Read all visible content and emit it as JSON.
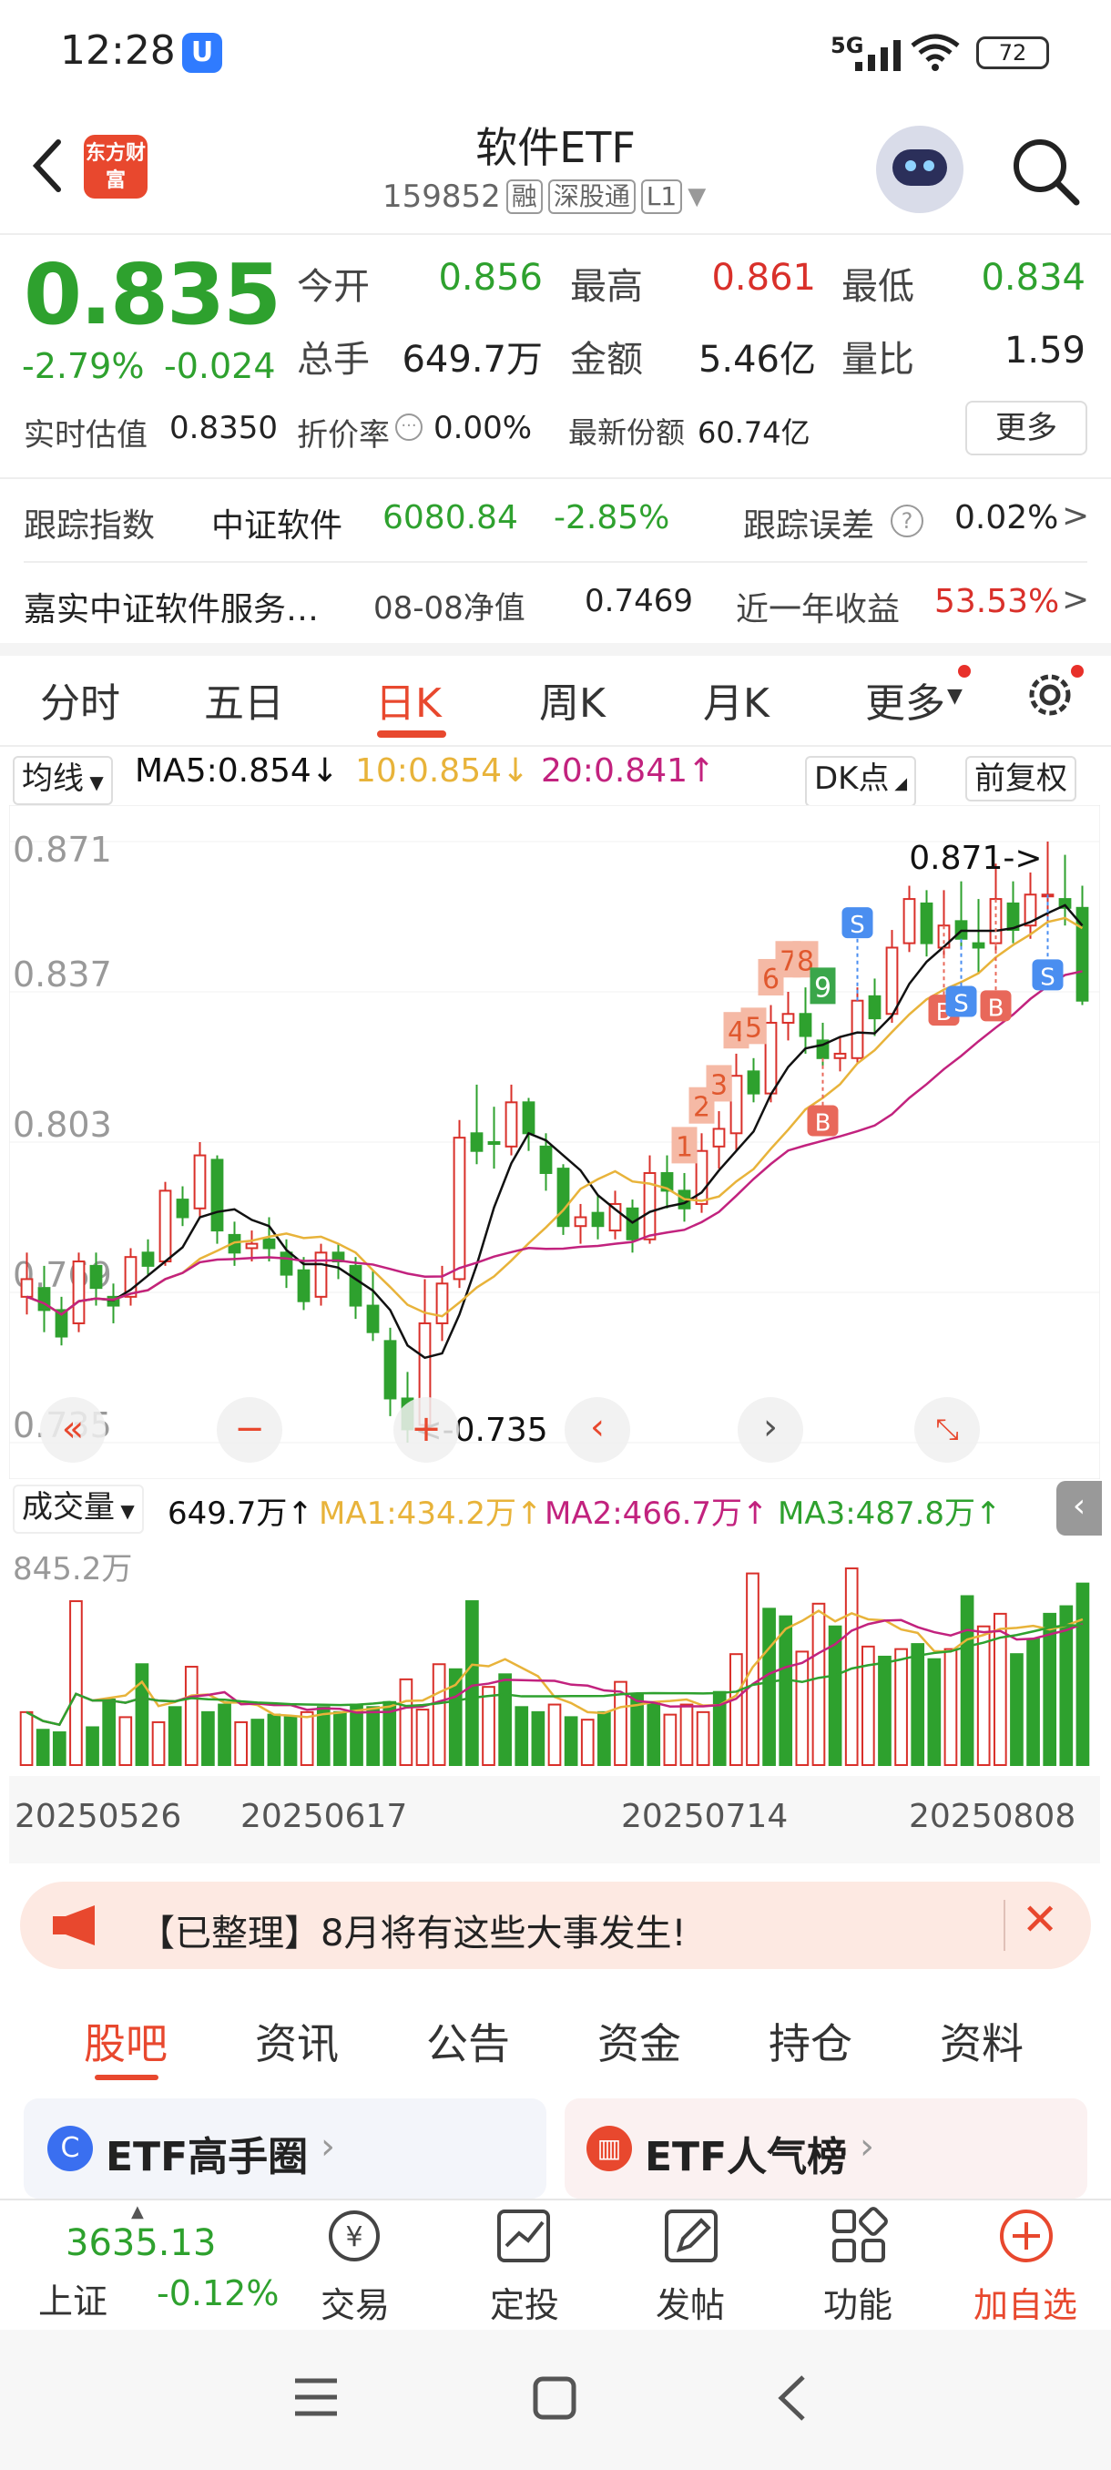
{
  "status_bar": {
    "time": "12:28",
    "network": "5G",
    "battery": "72"
  },
  "header": {
    "logo_text": "东方财富",
    "title": "软件ETF",
    "code": "159852",
    "tags": [
      "融",
      "深股通",
      "L1"
    ]
  },
  "quote": {
    "price": "0.835",
    "change_pct": "-2.79%",
    "change_amt": "-0.024",
    "fields": [
      {
        "label": "今开",
        "value": "0.856",
        "color": "green"
      },
      {
        "label": "最高",
        "value": "0.861",
        "color": "red"
      },
      {
        "label": "最低",
        "value": "0.834",
        "color": "green"
      },
      {
        "label": "总手",
        "value": "649.7万",
        "color": "black"
      },
      {
        "label": "金额",
        "value": "5.46亿",
        "color": "black"
      },
      {
        "label": "量比",
        "value": "1.59",
        "color": "black"
      }
    ],
    "iopv_label": "实时估值",
    "iopv_value": "0.8350",
    "premium_label": "折价率",
    "premium_value": "0.00%",
    "shares_label": "最新份额",
    "shares_value": "60.74亿",
    "more_label": "更多"
  },
  "tracking": {
    "index_label": "跟踪指数",
    "index_name": "中证软件",
    "index_value": "6080.84",
    "index_pct": "-2.85%",
    "error_label": "跟踪误差",
    "error_value": "0.02%",
    "fund_name": "嘉实中证软件服务…",
    "nav_label": "08-08净值",
    "nav_value": "0.7469",
    "year_label": "近一年收益",
    "year_value": "53.53%"
  },
  "period_tabs": [
    "分时",
    "五日",
    "日K",
    "周K",
    "月K",
    "更多"
  ],
  "active_period": "日K",
  "chart_toolbar": {
    "ma_selector": "均线",
    "ma5": "MA5:0.854↓",
    "ma10": "10:0.854↓",
    "ma20": "20:0.841↑",
    "dk_label": "DK点",
    "adjust_label": "前复权"
  },
  "chart_data": {
    "type": "candlestick",
    "y_ticks": [
      "0.871",
      "0.837",
      "0.803",
      "0.769",
      "0.735"
    ],
    "ylim": [
      0.735,
      0.871
    ],
    "high_marker": "0.871->",
    "low_marker": "<-0.735",
    "x_ticks": [
      "20250526",
      "20250617",
      "20250714",
      "20250808"
    ],
    "candles": [
      [
        0.772,
        0.768,
        0.778,
        0.764,
        "up"
      ],
      [
        0.77,
        0.765,
        0.775,
        0.76,
        "down"
      ],
      [
        0.765,
        0.759,
        0.768,
        0.757,
        "down"
      ],
      [
        0.762,
        0.776,
        0.778,
        0.76,
        "up"
      ],
      [
        0.775,
        0.77,
        0.778,
        0.766,
        "down"
      ],
      [
        0.768,
        0.766,
        0.771,
        0.762,
        "down"
      ],
      [
        0.768,
        0.777,
        0.779,
        0.766,
        "up"
      ],
      [
        0.778,
        0.775,
        0.781,
        0.773,
        "down"
      ],
      [
        0.776,
        0.792,
        0.794,
        0.775,
        "up"
      ],
      [
        0.79,
        0.786,
        0.793,
        0.784,
        "down"
      ],
      [
        0.788,
        0.8,
        0.803,
        0.786,
        "up"
      ],
      [
        0.799,
        0.783,
        0.8,
        0.78,
        "down"
      ],
      [
        0.782,
        0.778,
        0.785,
        0.775,
        "down"
      ],
      [
        0.779,
        0.78,
        0.783,
        0.776,
        "up"
      ],
      [
        0.781,
        0.779,
        0.786,
        0.776,
        "down"
      ],
      [
        0.778,
        0.773,
        0.781,
        0.77,
        "down"
      ],
      [
        0.774,
        0.767,
        0.777,
        0.765,
        "down"
      ],
      [
        0.768,
        0.778,
        0.78,
        0.766,
        "up"
      ],
      [
        0.778,
        0.776,
        0.78,
        0.772,
        "down"
      ],
      [
        0.775,
        0.766,
        0.777,
        0.763,
        "down"
      ],
      [
        0.766,
        0.76,
        0.774,
        0.758,
        "down"
      ],
      [
        0.758,
        0.745,
        0.761,
        0.741,
        "down"
      ],
      [
        0.745,
        0.738,
        0.751,
        0.735,
        "down"
      ],
      [
        0.739,
        0.762,
        0.772,
        0.738,
        "up"
      ],
      [
        0.762,
        0.771,
        0.775,
        0.758,
        "up"
      ],
      [
        0.772,
        0.804,
        0.808,
        0.77,
        "up"
      ],
      [
        0.805,
        0.801,
        0.816,
        0.798,
        "down"
      ],
      [
        0.803,
        0.803,
        0.811,
        0.797,
        "down"
      ],
      [
        0.802,
        0.812,
        0.816,
        0.8,
        "up"
      ],
      [
        0.812,
        0.805,
        0.813,
        0.801,
        "down"
      ],
      [
        0.802,
        0.796,
        0.805,
        0.792,
        "down"
      ],
      [
        0.797,
        0.784,
        0.798,
        0.782,
        "down"
      ],
      [
        0.784,
        0.786,
        0.789,
        0.78,
        "up"
      ],
      [
        0.787,
        0.784,
        0.791,
        0.781,
        "down"
      ],
      [
        0.783,
        0.789,
        0.792,
        0.781,
        "up"
      ],
      [
        0.788,
        0.781,
        0.79,
        0.778,
        "down"
      ],
      [
        0.781,
        0.796,
        0.8,
        0.78,
        "up"
      ],
      [
        0.796,
        0.792,
        0.8,
        0.788,
        "down"
      ],
      [
        0.792,
        0.788,
        0.796,
        0.785,
        "down"
      ],
      [
        0.789,
        0.801,
        0.805,
        0.787,
        "up"
      ],
      [
        0.802,
        0.806,
        0.81,
        0.797,
        "up"
      ],
      [
        0.805,
        0.818,
        0.823,
        0.801,
        "up"
      ],
      [
        0.819,
        0.814,
        0.822,
        0.812,
        "down"
      ],
      [
        0.814,
        0.83,
        0.834,
        0.812,
        "up"
      ],
      [
        0.83,
        0.832,
        0.837,
        0.826,
        "up"
      ],
      [
        0.832,
        0.827,
        0.838,
        0.823,
        "down"
      ],
      [
        0.826,
        0.822,
        0.83,
        0.82,
        "down"
      ],
      [
        0.822,
        0.823,
        0.827,
        0.819,
        "up"
      ],
      [
        0.822,
        0.835,
        0.838,
        0.821,
        "up"
      ],
      [
        0.836,
        0.831,
        0.84,
        0.827,
        "down"
      ],
      [
        0.832,
        0.847,
        0.851,
        0.83,
        "up"
      ],
      [
        0.848,
        0.858,
        0.861,
        0.846,
        "up"
      ],
      [
        0.857,
        0.848,
        0.86,
        0.845,
        "down"
      ],
      [
        0.847,
        0.852,
        0.86,
        0.845,
        "up"
      ],
      [
        0.853,
        0.849,
        0.862,
        0.847,
        "down"
      ],
      [
        0.848,
        0.847,
        0.858,
        0.841,
        "down"
      ],
      [
        0.848,
        0.858,
        0.866,
        0.846,
        "up"
      ],
      [
        0.857,
        0.851,
        0.862,
        0.848,
        "down"
      ],
      [
        0.852,
        0.859,
        0.864,
        0.849,
        "up"
      ],
      [
        0.859,
        0.859,
        0.871,
        0.853,
        "up"
      ],
      [
        0.858,
        0.856,
        0.868,
        0.852,
        "down"
      ],
      [
        0.856,
        0.835,
        0.861,
        0.834,
        "down"
      ]
    ],
    "ma5_last": 0.854,
    "ma10_last": 0.854,
    "ma20_last": 0.841,
    "signals": [
      "1",
      "2",
      "3",
      "4",
      "5",
      "6",
      "7",
      "8",
      "9"
    ],
    "buy_sell_labels": [
      "B",
      "S"
    ],
    "volume": {
      "selector": "成交量",
      "current": "649.7万↑",
      "ma1": "MA1:434.2万↑",
      "ma2": "MA2:466.7万↑",
      "ma3": "MA3:487.8万↑",
      "max_label": "845.2万",
      "values": [
        210,
        140,
        130,
        650,
        150,
        260,
        190,
        400,
        170,
        230,
        390,
        210,
        240,
        170,
        180,
        200,
        190,
        210,
        230,
        210,
        240,
        230,
        250,
        340,
        220,
        400,
        380,
        650,
        310,
        360,
        230,
        210,
        240,
        190,
        180,
        210,
        330,
        280,
        250,
        200,
        240,
        210,
        290,
        440,
        760,
        620,
        590,
        450,
        640,
        550,
        780,
        470,
        430,
        460,
        480,
        420,
        460,
        670,
        550,
        600,
        440,
        500,
        600,
        630,
        720
      ]
    }
  },
  "notice": {
    "text": "【已整理】8月将有这些大事发生!"
  },
  "content_tabs": [
    "股吧",
    "资讯",
    "公告",
    "资金",
    "持仓",
    "资料"
  ],
  "active_content_tab": "股吧",
  "cards": [
    {
      "title": "ETF高手圈"
    },
    {
      "title": "ETF人气榜"
    }
  ],
  "bottom_nav": {
    "index_value": "3635.13",
    "index_name": "上证",
    "index_pct": "-0.12%",
    "items": [
      "交易",
      "定投",
      "发帖",
      "功能",
      "加自选"
    ]
  },
  "colors": {
    "up": "#d9302a",
    "down": "#2ea12e",
    "accent": "#e8482e",
    "ma5": "#111111",
    "ma10": "#e8b33a",
    "ma20": "#c2227e"
  }
}
